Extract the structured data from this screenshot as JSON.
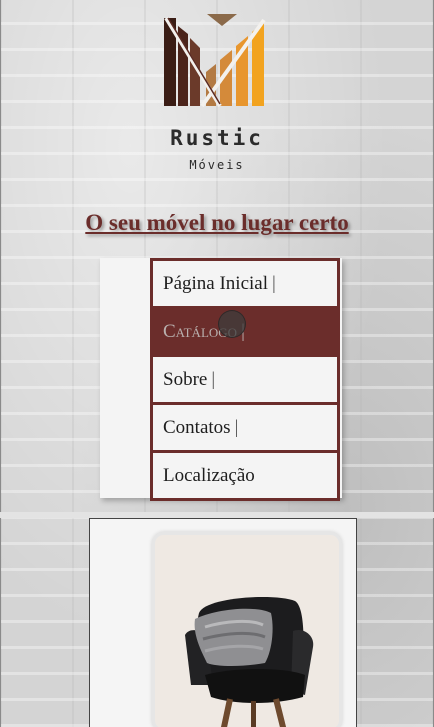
{
  "brand": {
    "name": "Rustic",
    "subtitle": "Móveis"
  },
  "header": {
    "tagline": "O seu móvel no lugar certo"
  },
  "nav": {
    "separator": "|",
    "items": [
      {
        "label": "Página Inicial",
        "active": false
      },
      {
        "label": "Catálogo",
        "active": true
      },
      {
        "label": "Sobre",
        "active": false
      },
      {
        "label": "Contatos",
        "active": false
      },
      {
        "label": "Localização",
        "active": false
      }
    ]
  },
  "colors": {
    "accent": "#6b2d2b",
    "nav_background": "#f4f4f4",
    "active_text": "#b9b0ae"
  },
  "catalog": {
    "product_image": "black-armchair-with-gray-pillow"
  }
}
